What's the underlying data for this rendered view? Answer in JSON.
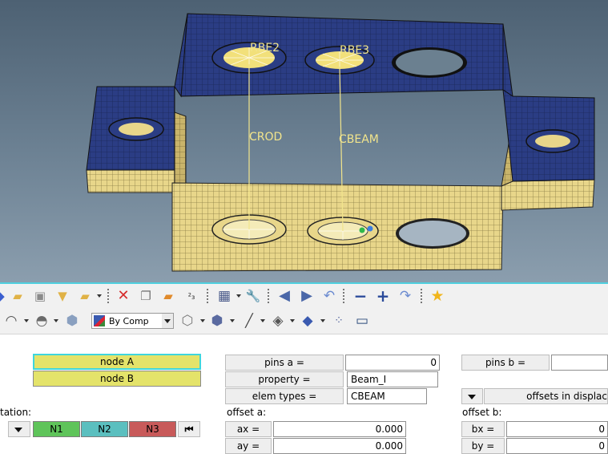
{
  "viewport": {
    "labels": {
      "rbe2": "RBE2",
      "rbe3": "RBE3",
      "crod": "CROD",
      "cbeam": "CBEAM"
    },
    "colors": {
      "top_part": "#2b3d84",
      "bottom_part": "#e8d68a",
      "element_line": "#f2e58c",
      "selection_edge": "#4fd0df"
    }
  },
  "toolbar_row1": {
    "icons": [
      "open-session-icon",
      "open-folder-icon",
      "import-geometry-icon",
      "import-model-icon",
      "export-icon",
      "delete-icon",
      "mask-icon",
      "find-icon",
      "renumber-icon",
      "window-layout-icon",
      "tools-wrench-icon",
      "arrow-left-icon",
      "arrow-right-icon",
      "undo-curve-icon",
      "minus-icon",
      "plus-icon",
      "redo-curve-icon",
      "favorite-star-icon"
    ]
  },
  "toolbar_row2": {
    "color_mode": {
      "selected": "By Comp"
    },
    "icons": [
      "surface-style-icon",
      "shaded-surface-icon",
      "solid-cube-icon",
      "cube-style-icon",
      "wireframe-cube-icon",
      "shaded-cube-icon",
      "line-style-icon",
      "plane-layers-icon",
      "shaded-layers-icon",
      "visualization-grid-icon",
      "monitor-icon"
    ]
  },
  "panel": {
    "node_a": "node A",
    "node_b": "node B",
    "orientation_label": "tation:",
    "n1": "N1",
    "n2": "N2",
    "n3": "N3",
    "pins_a_label": "pins  a =",
    "pins_a_value": "0",
    "property_label": "property =",
    "property_value": "Beam_I",
    "elem_types_label": "elem types =",
    "elem_types_value": "CBEAM",
    "offset_a_label": "offset a:",
    "ax_label": "ax =",
    "ax_value": "0.000",
    "ay_label": "ay =",
    "ay_value": "0.000",
    "pins_b_label": "pins b =",
    "pins_b_value": "",
    "offsets_in_label": "offsets in displac",
    "offset_b_label": "offset b:",
    "bx_label": "bx =",
    "bx_value": "0",
    "by_label": "by =",
    "by_value": "0",
    "n_colors": {
      "n1": "#5fc45a",
      "n2": "#5bbfbf",
      "n3": "#c85a5a"
    }
  }
}
